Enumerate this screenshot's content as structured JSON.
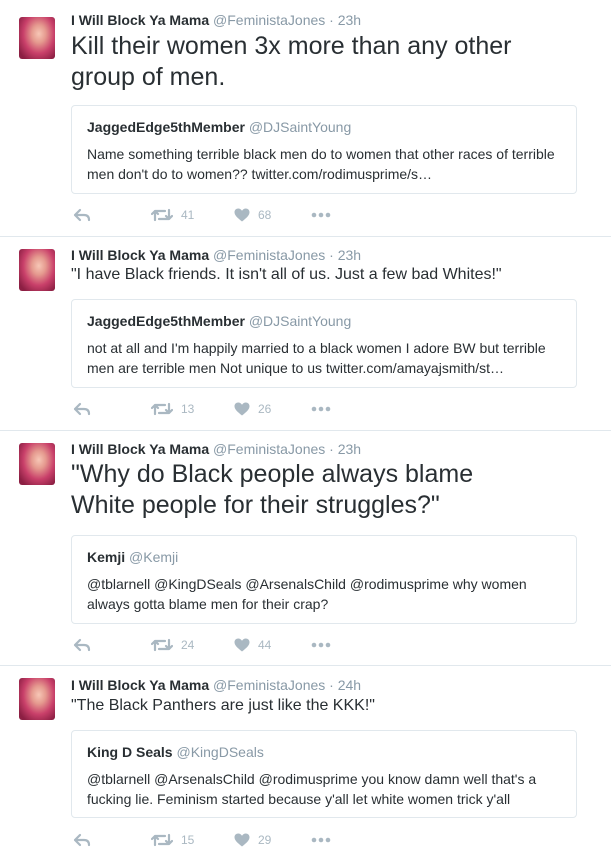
{
  "tweets": [
    {
      "name": "I Will Block Ya Mama",
      "handle": "@FeministaJones",
      "time": "· 23h",
      "text_lines": [
        "Kill their women 3x more than any other",
        "group of men."
      ],
      "quote": {
        "name": "JaggedEdge5thMember",
        "handle": "@DJSaintYoung",
        "lines": [
          "Name something terrible black men do to women that other races of terrible",
          "men don't do to women??  twitter.com/rodimusprime/s…"
        ]
      },
      "retweets": "41",
      "likes": "68"
    },
    {
      "name": "I Will Block Ya Mama",
      "handle": "@FeministaJones",
      "time": "· 23h",
      "text_lines": [
        "\"I have Black friends. It isn't all of us. Just a few bad Whites!\""
      ],
      "quote": {
        "name": "JaggedEdge5thMember",
        "handle": "@DJSaintYoung",
        "lines": [
          "not at all and I'm happily married to a black women I adore BW but terrible",
          "men are terrible men Not unique to us twitter.com/amayajsmith/st…"
        ]
      },
      "retweets": "13",
      "likes": "26"
    },
    {
      "name": "I Will Block Ya Mama",
      "handle": "@FeministaJones",
      "time": "· 23h",
      "text_lines": [
        "\"Why do Black people always blame",
        "White people for their struggles?\""
      ],
      "quote": {
        "name": "Kemji",
        "handle": "@Kemji",
        "lines": [
          "@tblarnell @KingDSeals @ArsenalsChild @rodimusprime why women",
          "always gotta blame men for their crap?"
        ]
      },
      "retweets": "24",
      "likes": "44"
    },
    {
      "name": "I Will Block Ya Mama",
      "handle": "@FeministaJones",
      "time": "· 24h",
      "text_lines": [
        "\"The Black Panthers are just like the KKK!\""
      ],
      "quote": {
        "name": "King D Seals",
        "handle": "@KingDSeals",
        "lines": [
          "@tblarnell @ArsenalsChild @rodimusprime you know damn well that's a",
          "fucking lie. Feminism started because y'all let white women trick y'all"
        ]
      },
      "retweets": "15",
      "likes": "29"
    }
  ],
  "icons": {
    "reply": "reply-icon",
    "retweet": "retweet-icon",
    "like": "heart-icon",
    "more": "more-icon"
  },
  "colors": {
    "text": "#292f33",
    "muted": "#8899a6",
    "action": "#aab8c2",
    "border": "#e1e8ed"
  }
}
